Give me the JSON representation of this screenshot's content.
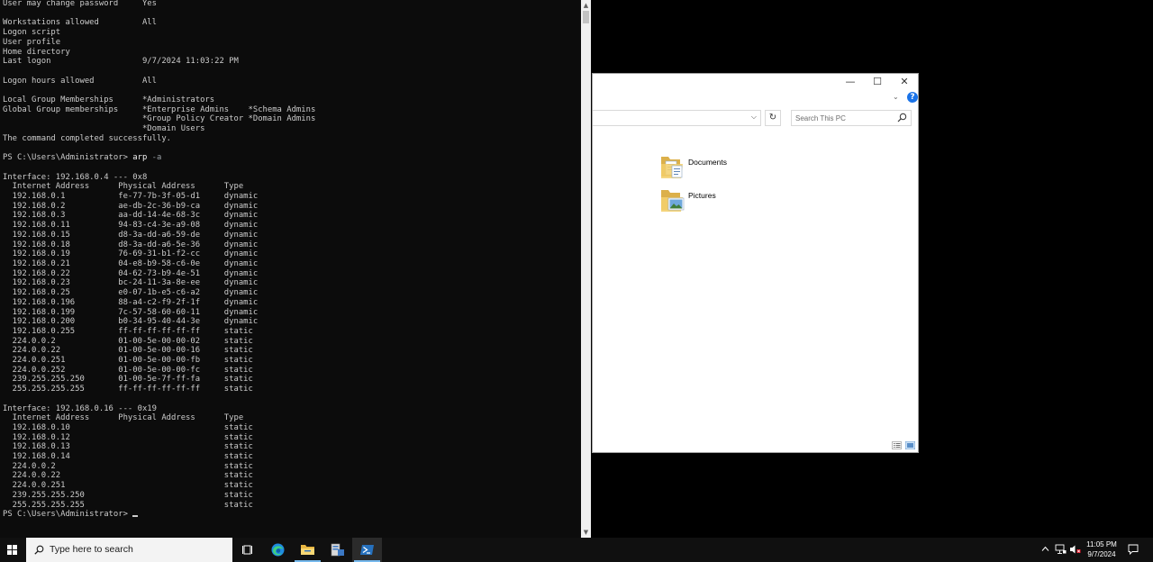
{
  "terminal": {
    "lines": [
      {
        "text": "User may change password     Yes"
      },
      {
        "text": ""
      },
      {
        "text": "Workstations allowed         All"
      },
      {
        "text": "Logon script"
      },
      {
        "text": "User profile"
      },
      {
        "text": "Home directory"
      },
      {
        "text": "Last logon                   9/7/2024 11:03:22 PM"
      },
      {
        "text": ""
      },
      {
        "text": "Logon hours allowed          All"
      },
      {
        "text": ""
      },
      {
        "text": "Local Group Memberships      *Administrators"
      },
      {
        "text": "Global Group memberships     *Enterprise Admins    *Schema Admins"
      },
      {
        "text": "                             *Group Policy Creator *Domain Admins"
      },
      {
        "text": "                             *Domain Users"
      },
      {
        "text": "The command completed successfully."
      },
      {
        "text": ""
      },
      {
        "prompt": "PS C:\\Users\\Administrator> ",
        "cmd": "arp",
        "arg": " -a"
      },
      {
        "text": ""
      },
      {
        "text": "Interface: 192.168.0.4 --- 0x8"
      },
      {
        "text": "  Internet Address      Physical Address      Type"
      },
      {
        "text": "  192.168.0.1           fe-77-7b-3f-05-d1     dynamic"
      },
      {
        "text": "  192.168.0.2           ae-db-2c-36-b9-ca     dynamic"
      },
      {
        "text": "  192.168.0.3           aa-dd-14-4e-68-3c     dynamic"
      },
      {
        "text": "  192.168.0.11          94-83-c4-3e-a9-08     dynamic"
      },
      {
        "text": "  192.168.0.15          d8-3a-dd-a6-59-de     dynamic"
      },
      {
        "text": "  192.168.0.18          d8-3a-dd-a6-5e-36     dynamic"
      },
      {
        "text": "  192.168.0.19          76-69-31-b1-f2-cc     dynamic"
      },
      {
        "text": "  192.168.0.21          04-e8-b9-58-c6-0e     dynamic"
      },
      {
        "text": "  192.168.0.22          04-62-73-b9-4e-51     dynamic"
      },
      {
        "text": "  192.168.0.23          bc-24-11-3a-8e-ee     dynamic"
      },
      {
        "text": "  192.168.0.25          e0-07-1b-e5-c6-a2     dynamic"
      },
      {
        "text": "  192.168.0.196         88-a4-c2-f9-2f-1f     dynamic"
      },
      {
        "text": "  192.168.0.199         7c-57-58-60-60-11     dynamic"
      },
      {
        "text": "  192.168.0.200         b0-34-95-40-44-3e     dynamic"
      },
      {
        "text": "  192.168.0.255         ff-ff-ff-ff-ff-ff     static"
      },
      {
        "text": "  224.0.0.2             01-00-5e-00-00-02     static"
      },
      {
        "text": "  224.0.0.22            01-00-5e-00-00-16     static"
      },
      {
        "text": "  224.0.0.251           01-00-5e-00-00-fb     static"
      },
      {
        "text": "  224.0.0.252           01-00-5e-00-00-fc     static"
      },
      {
        "text": "  239.255.255.250       01-00-5e-7f-ff-fa     static"
      },
      {
        "text": "  255.255.255.255       ff-ff-ff-ff-ff-ff     static"
      },
      {
        "text": ""
      },
      {
        "text": "Interface: 192.168.0.16 --- 0x19"
      },
      {
        "text": "  Internet Address      Physical Address      Type"
      },
      {
        "text": "  192.168.0.10                                static"
      },
      {
        "text": "  192.168.0.12                                static"
      },
      {
        "text": "  192.168.0.13                                static"
      },
      {
        "text": "  192.168.0.14                                static"
      },
      {
        "text": "  224.0.0.2                                   static"
      },
      {
        "text": "  224.0.0.22                                  static"
      },
      {
        "text": "  224.0.0.251                                 static"
      },
      {
        "text": "  239.255.255.250                             static"
      },
      {
        "text": "  255.255.255.255                             static"
      },
      {
        "prompt": "PS C:\\Users\\Administrator> ",
        "cursor": true
      }
    ]
  },
  "explorer": {
    "search_placeholder": "Search This PC",
    "folders": [
      {
        "label": "Documents"
      },
      {
        "label": "Pictures"
      }
    ]
  },
  "taskbar": {
    "search_text": "Type here to search",
    "time": "11:05 PM",
    "date": "9/7/2024"
  }
}
